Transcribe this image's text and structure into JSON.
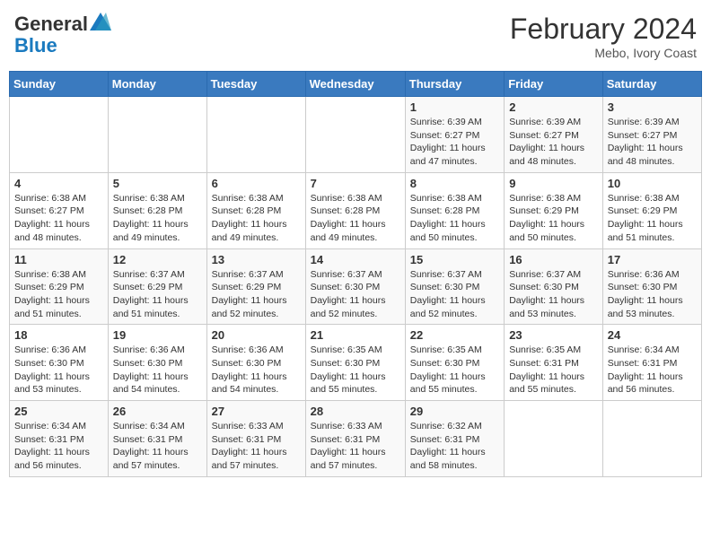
{
  "header": {
    "logo_general": "General",
    "logo_blue": "Blue",
    "month_title": "February 2024",
    "location": "Mebo, Ivory Coast"
  },
  "days_of_week": [
    "Sunday",
    "Monday",
    "Tuesday",
    "Wednesday",
    "Thursday",
    "Friday",
    "Saturday"
  ],
  "weeks": [
    [
      {
        "day": "",
        "info": ""
      },
      {
        "day": "",
        "info": ""
      },
      {
        "day": "",
        "info": ""
      },
      {
        "day": "",
        "info": ""
      },
      {
        "day": "1",
        "info": "Sunrise: 6:39 AM\nSunset: 6:27 PM\nDaylight: 11 hours and 47 minutes."
      },
      {
        "day": "2",
        "info": "Sunrise: 6:39 AM\nSunset: 6:27 PM\nDaylight: 11 hours and 48 minutes."
      },
      {
        "day": "3",
        "info": "Sunrise: 6:39 AM\nSunset: 6:27 PM\nDaylight: 11 hours and 48 minutes."
      }
    ],
    [
      {
        "day": "4",
        "info": "Sunrise: 6:38 AM\nSunset: 6:27 PM\nDaylight: 11 hours and 48 minutes."
      },
      {
        "day": "5",
        "info": "Sunrise: 6:38 AM\nSunset: 6:28 PM\nDaylight: 11 hours and 49 minutes."
      },
      {
        "day": "6",
        "info": "Sunrise: 6:38 AM\nSunset: 6:28 PM\nDaylight: 11 hours and 49 minutes."
      },
      {
        "day": "7",
        "info": "Sunrise: 6:38 AM\nSunset: 6:28 PM\nDaylight: 11 hours and 49 minutes."
      },
      {
        "day": "8",
        "info": "Sunrise: 6:38 AM\nSunset: 6:28 PM\nDaylight: 11 hours and 50 minutes."
      },
      {
        "day": "9",
        "info": "Sunrise: 6:38 AM\nSunset: 6:29 PM\nDaylight: 11 hours and 50 minutes."
      },
      {
        "day": "10",
        "info": "Sunrise: 6:38 AM\nSunset: 6:29 PM\nDaylight: 11 hours and 51 minutes."
      }
    ],
    [
      {
        "day": "11",
        "info": "Sunrise: 6:38 AM\nSunset: 6:29 PM\nDaylight: 11 hours and 51 minutes."
      },
      {
        "day": "12",
        "info": "Sunrise: 6:37 AM\nSunset: 6:29 PM\nDaylight: 11 hours and 51 minutes."
      },
      {
        "day": "13",
        "info": "Sunrise: 6:37 AM\nSunset: 6:29 PM\nDaylight: 11 hours and 52 minutes."
      },
      {
        "day": "14",
        "info": "Sunrise: 6:37 AM\nSunset: 6:30 PM\nDaylight: 11 hours and 52 minutes."
      },
      {
        "day": "15",
        "info": "Sunrise: 6:37 AM\nSunset: 6:30 PM\nDaylight: 11 hours and 52 minutes."
      },
      {
        "day": "16",
        "info": "Sunrise: 6:37 AM\nSunset: 6:30 PM\nDaylight: 11 hours and 53 minutes."
      },
      {
        "day": "17",
        "info": "Sunrise: 6:36 AM\nSunset: 6:30 PM\nDaylight: 11 hours and 53 minutes."
      }
    ],
    [
      {
        "day": "18",
        "info": "Sunrise: 6:36 AM\nSunset: 6:30 PM\nDaylight: 11 hours and 53 minutes."
      },
      {
        "day": "19",
        "info": "Sunrise: 6:36 AM\nSunset: 6:30 PM\nDaylight: 11 hours and 54 minutes."
      },
      {
        "day": "20",
        "info": "Sunrise: 6:36 AM\nSunset: 6:30 PM\nDaylight: 11 hours and 54 minutes."
      },
      {
        "day": "21",
        "info": "Sunrise: 6:35 AM\nSunset: 6:30 PM\nDaylight: 11 hours and 55 minutes."
      },
      {
        "day": "22",
        "info": "Sunrise: 6:35 AM\nSunset: 6:30 PM\nDaylight: 11 hours and 55 minutes."
      },
      {
        "day": "23",
        "info": "Sunrise: 6:35 AM\nSunset: 6:31 PM\nDaylight: 11 hours and 55 minutes."
      },
      {
        "day": "24",
        "info": "Sunrise: 6:34 AM\nSunset: 6:31 PM\nDaylight: 11 hours and 56 minutes."
      }
    ],
    [
      {
        "day": "25",
        "info": "Sunrise: 6:34 AM\nSunset: 6:31 PM\nDaylight: 11 hours and 56 minutes."
      },
      {
        "day": "26",
        "info": "Sunrise: 6:34 AM\nSunset: 6:31 PM\nDaylight: 11 hours and 57 minutes."
      },
      {
        "day": "27",
        "info": "Sunrise: 6:33 AM\nSunset: 6:31 PM\nDaylight: 11 hours and 57 minutes."
      },
      {
        "day": "28",
        "info": "Sunrise: 6:33 AM\nSunset: 6:31 PM\nDaylight: 11 hours and 57 minutes."
      },
      {
        "day": "29",
        "info": "Sunrise: 6:32 AM\nSunset: 6:31 PM\nDaylight: 11 hours and 58 minutes."
      },
      {
        "day": "",
        "info": ""
      },
      {
        "day": "",
        "info": ""
      }
    ]
  ]
}
